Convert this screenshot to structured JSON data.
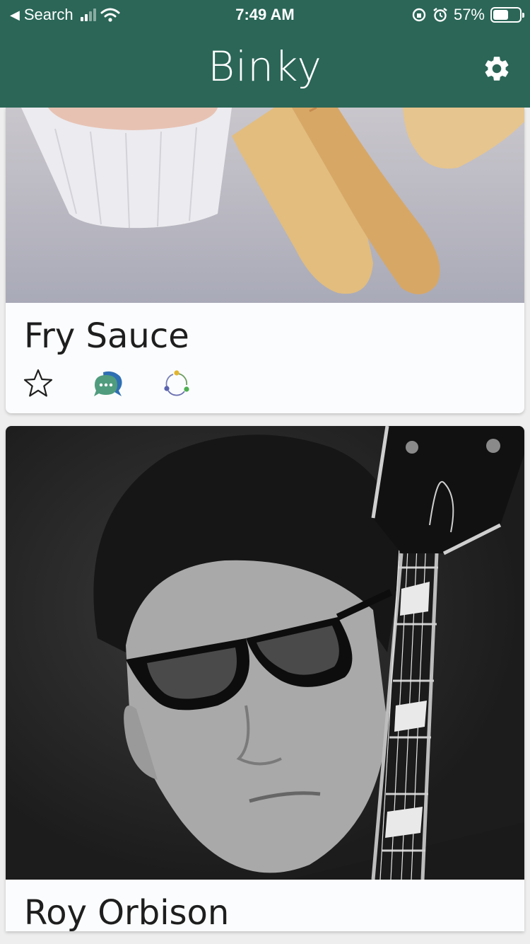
{
  "status_bar": {
    "back_label": "Search",
    "time": "7:49 AM",
    "battery_percent": "57%",
    "battery_level": 0.57
  },
  "app_bar": {
    "title": "Binky",
    "settings_icon": "gear-icon"
  },
  "colors": {
    "brand": "#2b6657",
    "chat_green": "#4f9c7e",
    "chat_blue": "#2f6fb3"
  },
  "posts": [
    {
      "title": "Fry Sauce",
      "photo": "fry-sauce-photo",
      "actions": [
        "star-icon",
        "chat-bubble-icon",
        "share-dots-icon"
      ]
    },
    {
      "title": "Roy Orbison",
      "photo": "roy-orbison-photo"
    }
  ]
}
